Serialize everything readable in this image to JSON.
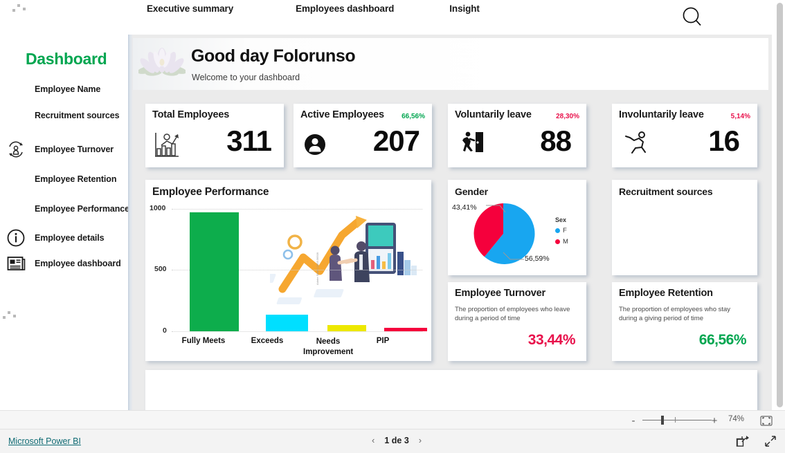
{
  "topnav": {
    "tabs": [
      {
        "label": "Executive summary",
        "name": "tab-executive-summary"
      },
      {
        "label": "Employees dashboard",
        "name": "tab-employees-dashboard"
      },
      {
        "label": "Insight",
        "name": "tab-insight"
      }
    ],
    "search_icon": "search-icon"
  },
  "sidebar": {
    "title": "Dashboard",
    "title_color": "#00a650",
    "items": [
      {
        "label": "Employee Name",
        "icon": ""
      },
      {
        "label": "Recruitment sources",
        "icon": ""
      },
      {
        "label": "Employee Turnover",
        "icon": "turnover-cycle-icon"
      },
      {
        "label": "Employee Retention",
        "icon": ""
      },
      {
        "label": "Employee Performance",
        "icon": ""
      },
      {
        "label": "Employee details",
        "icon": "info-circle-icon"
      },
      {
        "label": "Employee dashboard",
        "icon": "news-article-icon"
      }
    ]
  },
  "hero": {
    "greeting": "Good day Folorunso",
    "subtitle": "Welcome to your dashboard",
    "image": "lotus-flower-image"
  },
  "kpis": [
    {
      "title": "Total Employees",
      "value": "311",
      "pct": "",
      "pct_color": "",
      "icon": "bar-chart-person-icon"
    },
    {
      "title": "Active Employees",
      "value": "207",
      "pct": "66,56%",
      "pct_color": "#00a650",
      "icon": "person-badge-icon"
    },
    {
      "title": "Voluntarily leave",
      "value": "88",
      "pct": "28,30%",
      "pct_color": "#e8114b",
      "icon": "exit-running-icon"
    },
    {
      "title": "Involuntarily leave",
      "value": "16",
      "pct": "5,14%",
      "pct_color": "#e8114b",
      "icon": "running-person-icon"
    }
  ],
  "recruitment_card": {
    "title": "Recruitment sources"
  },
  "turnover_card": {
    "title": "Employee Turnover",
    "description": "The proportion of employees who leave during a period of time",
    "value": "33,44%",
    "value_color": "#e8114b"
  },
  "retention_card": {
    "title": "Employee Retention",
    "description": "The proportion of employees who stay during a giving period of time",
    "value": "66,56%",
    "value_color": "#00a650"
  },
  "statusbar": {
    "zoom_minus": "-",
    "zoom_plus": "+",
    "zoom_level": "74%",
    "fit_icon": "fit-to-page-icon"
  },
  "footer": {
    "brand": "Microsoft Power BI",
    "prev_icon": "chevron-left-icon",
    "next_icon": "chevron-right-icon",
    "page_text": "1 de 3",
    "share_icon": "share-icon",
    "fullscreen_icon": "fullscreen-icon"
  },
  "chart_data": [
    {
      "type": "bar",
      "title": "Employee Performance",
      "categories": [
        "Fully Meets",
        "Exceeds",
        "Needs Improvement",
        "PIP"
      ],
      "values": [
        970,
        135,
        48,
        22
      ],
      "colors": [
        "#0dad4c",
        "#00dfff",
        "#ede800",
        "#f5003c"
      ],
      "xlabel": "",
      "ylabel": "",
      "ylim": [
        0,
        1000
      ],
      "yticks": [
        0,
        500,
        1000
      ],
      "ytick_labels": [
        "0",
        "500",
        "1000"
      ],
      "grid": true,
      "legend": "none"
    },
    {
      "type": "pie",
      "title": "Gender",
      "categories": [
        "F",
        "M"
      ],
      "values": [
        56.59,
        43.41
      ],
      "data_labels": [
        "56,59%",
        "43,41%"
      ],
      "colors": [
        "#18a6f0",
        "#f5003c"
      ],
      "legend_title": "Sex",
      "legend": "right"
    }
  ]
}
